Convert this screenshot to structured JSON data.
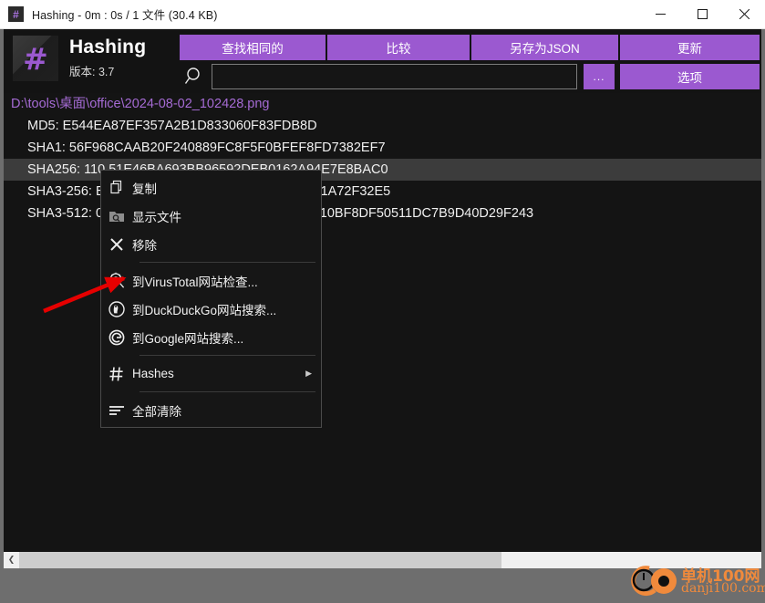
{
  "window": {
    "title": "Hashing - 0m : 0s / 1 文件 (30.4 KB)",
    "icon": "hash-icon",
    "minimize_label": "minimize-icon",
    "maximize_label": "maximize-icon",
    "close_label": "close-icon"
  },
  "toolbar": {
    "app_name": "Hashing",
    "version": "版本: 3.7",
    "logo_glyph": "#",
    "find_duplicates": "查找相同的",
    "compare": "比较",
    "save_as_json": "另存为JSON",
    "update": "更新",
    "browse": "...",
    "options": "选项",
    "search_value": "",
    "search_placeholder": ""
  },
  "list": {
    "rows": [
      {
        "type": "path",
        "text": "D:\\tools\\桌面\\office\\2024-08-02_102428.png",
        "selected": false
      },
      {
        "type": "hash",
        "text": "MD5: E544EA87EF357A2B1D833060F83FDB8D",
        "selected": false
      },
      {
        "type": "hash",
        "text": "SHA1: 56F968CAAB20F240889FC8F5F0BFEF8FD7382EF7",
        "selected": false
      },
      {
        "type": "hash",
        "text": "SHA256: 110                                     51E46BA693BB96592DEB0162A94E7E8BAC0",
        "selected": true
      },
      {
        "type": "hash",
        "text": "SHA3-256:                                    E7A3B4521D49A59DF2471CDB2C101A72F32E5",
        "selected": false
      },
      {
        "type": "hash",
        "text": "SHA3-512: 0                                  1F2BEBCEAF72858EEEFA70CBA910BF8DF50511DC7B9D40D29F243",
        "selected": false
      }
    ]
  },
  "context_menu": {
    "items": [
      {
        "label": "复制",
        "icon": "copy-icon",
        "submenu": false
      },
      {
        "label": "显示文件",
        "icon": "folder-search-icon",
        "submenu": false
      },
      {
        "label": "移除",
        "icon": "close-x-icon",
        "submenu": false
      },
      {
        "label": "到VirusTotal网站检查...",
        "icon": "virustotal-icon",
        "submenu": false
      },
      {
        "label": "到DuckDuckGo网站搜索...",
        "icon": "duckduckgo-icon",
        "submenu": false
      },
      {
        "label": "到Google网站搜索...",
        "icon": "google-icon",
        "submenu": false
      },
      {
        "label": "Hashes",
        "icon": "hash-icon",
        "submenu": true,
        "submenu_arrow": "▶"
      },
      {
        "label": "全部清除",
        "icon": "clear-all-icon",
        "submenu": false
      }
    ]
  },
  "watermark": {
    "line1": "单机100网",
    "line2": "danji100.com"
  },
  "scrollbar": {
    "left_arrow": "❮"
  },
  "colors": {
    "accent": "#9b59d0",
    "path_text": "#a56bd4",
    "list_background": "#141414",
    "toolbar_background": "#131313",
    "selection": "#3c3c3c",
    "watermark": "#f08a3c",
    "annotation_arrow": "#e60000"
  }
}
